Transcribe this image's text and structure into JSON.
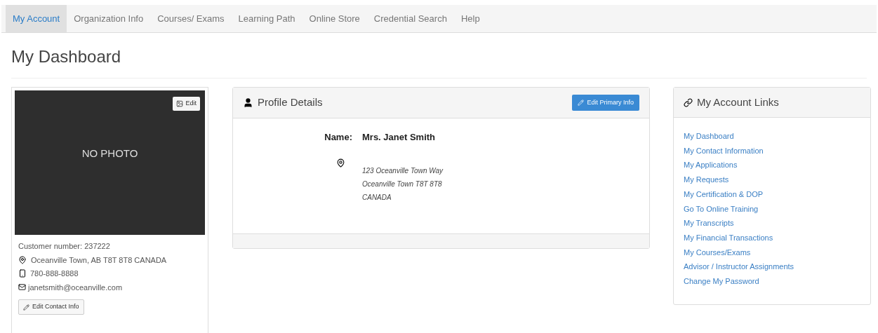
{
  "nav": [
    {
      "label": "My Account",
      "selected": true
    },
    {
      "label": "Organization Info",
      "selected": false
    },
    {
      "label": "Courses/ Exams",
      "selected": false
    },
    {
      "label": "Learning Path",
      "selected": false
    },
    {
      "label": "Online Store",
      "selected": false
    },
    {
      "label": "Credential Search",
      "selected": false
    },
    {
      "label": "Help",
      "selected": false
    }
  ],
  "page_title": "My Dashboard",
  "profile_card": {
    "photo_text": "NO PHOTO",
    "photo_edit_button": "Edit",
    "customer_number": "Customer number: 237222",
    "address": "Oceanville Town, AB T8T 8T8 CANADA",
    "phone": "780-888-8888",
    "email": "janetsmith@oceanville.com",
    "edit_button": "Edit Contact Info"
  },
  "profile_details": {
    "title": "Profile Details",
    "edit_button": "Edit Primary Info",
    "name_label": "Name:",
    "name": "Mrs. Janet Smith",
    "address_lines": [
      "123 Oceanville Town Way",
      "Oceanville Town T8T 8T8",
      "CANADA"
    ]
  },
  "account_links": {
    "title": "My Account Links",
    "links": [
      "My Dashboard",
      "My Contact Information",
      "My Applications",
      "My Requests",
      "My Certification & DOP",
      "Go To Online Training",
      "My Transcripts",
      "My Financial Transactions",
      "My Courses/Exams",
      "Advisor / Instructor Assignments",
      "Change My Password"
    ]
  }
}
